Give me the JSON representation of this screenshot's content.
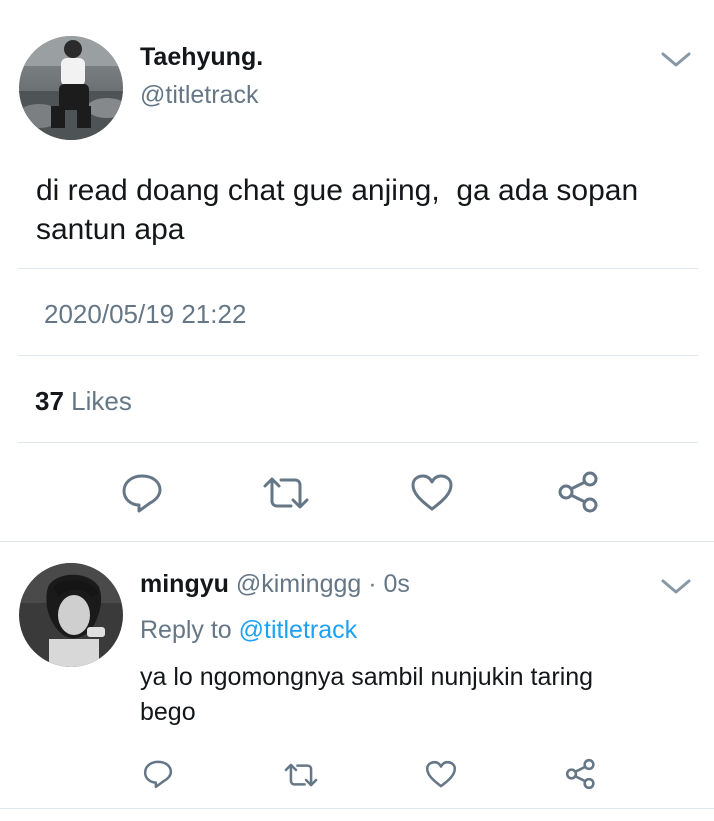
{
  "tweet": {
    "author_name": "Taehyung.",
    "author_handle": "@titletrack",
    "text_line1": "di read doang chat gue anjing,  ga ada sopan",
    "text_line2": "santun apa",
    "timestamp": "2020/05/19 21:22",
    "likes_count": "37",
    "likes_label": "Likes"
  },
  "reply": {
    "author_name": "mingyu",
    "author_handle": "@kiminggg",
    "time": "· 0s",
    "reply_to_prefix": "Reply to",
    "reply_to_handle": "@titletrack",
    "text_line1": "ya lo ngomongnya sambil nunjukin taring",
    "text_line2": "bego"
  },
  "icons": {
    "menu": "chevron-down-icon",
    "reply": "reply-icon",
    "retweet": "retweet-icon",
    "like": "heart-icon",
    "share": "share-icon"
  },
  "colors": {
    "text": "#14171a",
    "secondary": "#657786",
    "link": "#1da1f2",
    "divider": "#e1e8ed",
    "icon": "#657786"
  }
}
